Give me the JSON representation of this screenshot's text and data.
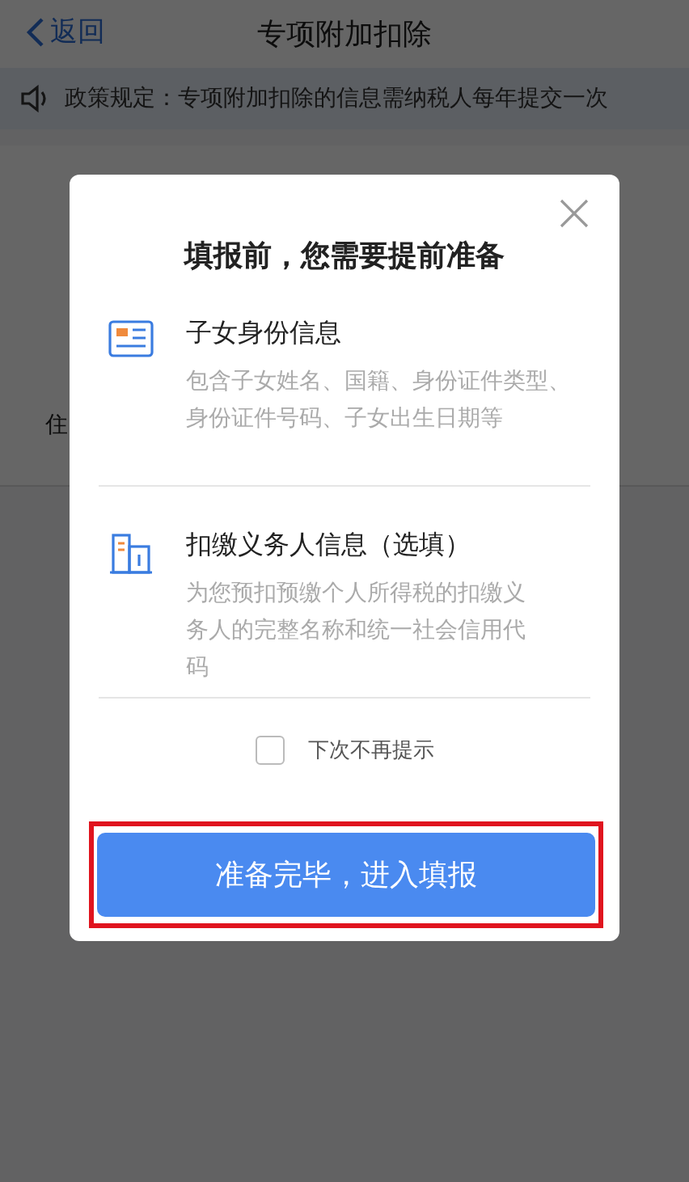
{
  "nav": {
    "back": "返回",
    "title": "专项附加扣除"
  },
  "notice": "政策规定：专项附加扣除的信息需纳税人每年提交一次",
  "background_row": {
    "label": "住"
  },
  "dialog": {
    "title": "填报前，您需要提前准备",
    "items": [
      {
        "kind": "id-card",
        "title": "子女身份信息",
        "description": "包含子女姓名、国籍、身份证件类型、身份证件号码、子女出生日期等"
      },
      {
        "kind": "building",
        "title": "扣缴义务人信息（选填）",
        "description": "为您预扣预缴个人所得税的扣缴义务人的完整名称和统一社会信用代码"
      }
    ],
    "dont_remind": {
      "label": "下次不再提示",
      "checked": false
    },
    "confirm": {
      "label": "准备完毕，进入填报",
      "highlighted": true
    }
  }
}
